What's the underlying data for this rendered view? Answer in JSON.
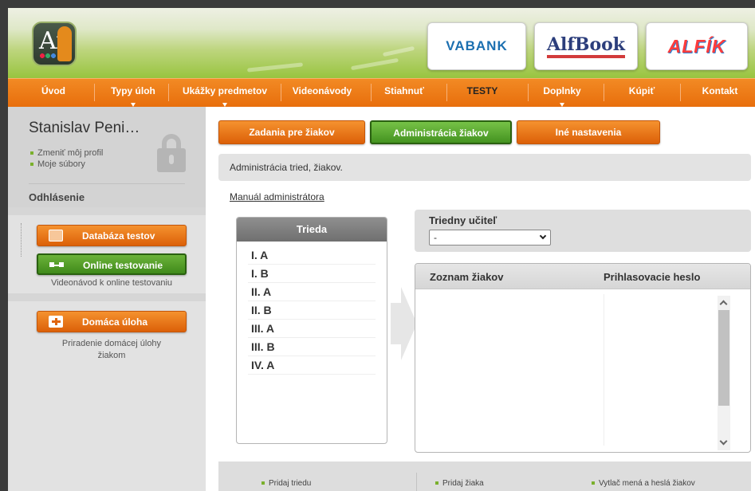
{
  "header": {
    "logo_text": "Af",
    "brands": [
      "VABANK",
      "AlfBook",
      "ALFÍK"
    ]
  },
  "nav": {
    "items": [
      {
        "label": "Úvod",
        "has_dropdown": false
      },
      {
        "label": "Typy úloh",
        "has_dropdown": true
      },
      {
        "label": "Ukážky predmetov",
        "has_dropdown": true
      },
      {
        "label": "Videonávody",
        "has_dropdown": false
      },
      {
        "label": "Stiahnuť",
        "has_dropdown": false
      },
      {
        "label": "TESTY",
        "has_dropdown": false,
        "active": true
      },
      {
        "label": "Doplnky",
        "has_dropdown": true
      },
      {
        "label": "Kúpiť",
        "has_dropdown": false
      },
      {
        "label": "Kontakt",
        "has_dropdown": false
      }
    ]
  },
  "sidebar": {
    "user_name": "Stanislav Peni…",
    "profile_link": "Zmeniť môj profil",
    "files_link": "Moje súbory",
    "logout": "Odhlásenie",
    "buttons": {
      "test_db": "Databáza testov",
      "online_testing": "Online testovanie",
      "online_note": "Videonávod k online testovaniu",
      "homework": "Domáca úloha",
      "homework_note": "Priradenie domácej úlohy žiakom"
    }
  },
  "main": {
    "tabs": [
      "Zadania pre žiakov",
      "Administrácia žiakov",
      "Iné nastavenia"
    ],
    "info_text": "Administrácia tried, žiakov.",
    "manual_link": "Manuál administrátora",
    "class_panel": {
      "header": "Trieda",
      "classes": [
        "I. A",
        "I. B",
        "II. A",
        "II. B",
        "III. A",
        "III. B",
        "IV. A"
      ]
    },
    "teacher": {
      "label": "Triedny učiteľ",
      "selected": "-"
    },
    "students": {
      "col_name": "Zoznam žiakov",
      "col_password": "Prihlasovacie heslo"
    },
    "footer_links": [
      "Pridaj triedu",
      "Pridaj žiaka",
      "Vytlač mená a heslá žiakov"
    ]
  },
  "colors": {
    "accent_orange": "#e86e0c",
    "accent_green": "#449320",
    "header_green": "#98c43f"
  }
}
